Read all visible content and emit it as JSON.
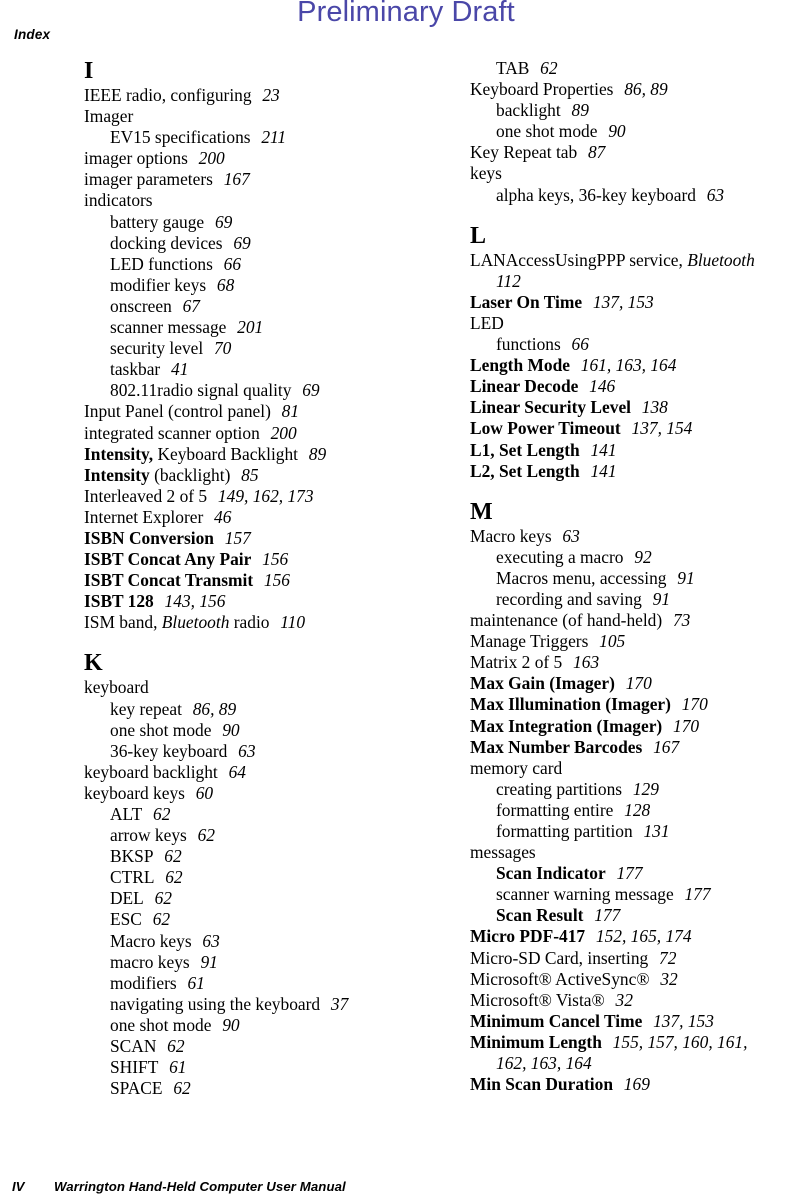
{
  "watermark": {
    "text": "Preliminary Draft",
    "color": "#4a47a8"
  },
  "running_head": {
    "text": "Index"
  },
  "footer": {
    "page_number": "IV",
    "title": "Warrington Hand-Held Computer User Manual"
  },
  "columns": {
    "left": {
      "sections": [
        {
          "letter": "I",
          "entries": [
            {
              "level": 1,
              "text": "IEEE radio, configuring",
              "pages": "23"
            },
            {
              "level": 1,
              "text": "Imager",
              "pages": ""
            },
            {
              "level": 2,
              "text": "EV15 specifications",
              "pages": "211"
            },
            {
              "level": 1,
              "text": "imager options",
              "pages": "200"
            },
            {
              "level": 1,
              "text": "imager parameters",
              "pages": "167"
            },
            {
              "level": 1,
              "text": "indicators",
              "pages": ""
            },
            {
              "level": 2,
              "text": "battery gauge",
              "pages": "69"
            },
            {
              "level": 2,
              "text": "docking devices",
              "pages": "69"
            },
            {
              "level": 2,
              "text": "LED functions",
              "pages": "66"
            },
            {
              "level": 2,
              "text": "modifier keys",
              "pages": "68"
            },
            {
              "level": 2,
              "text": "onscreen",
              "pages": "67"
            },
            {
              "level": 2,
              "text": "scanner message",
              "pages": "201"
            },
            {
              "level": 2,
              "text": "security level",
              "pages": "70"
            },
            {
              "level": 2,
              "text": "taskbar",
              "pages": "41"
            },
            {
              "level": 2,
              "text": "802.11radio signal quality",
              "pages": "69"
            },
            {
              "level": 1,
              "text": "Input Panel (control panel)",
              "pages": "81"
            },
            {
              "level": 1,
              "text": "integrated scanner option",
              "pages": "200"
            },
            {
              "level": 1,
              "bold_part": "Intensity,",
              "text": " Keyboard Backlight",
              "pages": "89"
            },
            {
              "level": 1,
              "bold_part": "Intensity",
              "text": " (backlight)",
              "pages": "85"
            },
            {
              "level": 1,
              "text": "Interleaved 2 of 5",
              "pages": "149, 162, 173"
            },
            {
              "level": 1,
              "text": "Internet Explorer",
              "pages": "46"
            },
            {
              "level": 1,
              "bold": true,
              "text": "ISBN Conversion",
              "pages": "157"
            },
            {
              "level": 1,
              "bold": true,
              "text": "ISBT Concat Any Pair",
              "pages": "156"
            },
            {
              "level": 1,
              "bold": true,
              "text": "ISBT Concat Transmit",
              "pages": "156"
            },
            {
              "level": 1,
              "bold": true,
              "text": "ISBT 128",
              "pages": "143, 156"
            },
            {
              "level": 1,
              "text": "ISM band, ",
              "italic_part": "Bluetooth",
              "text_after": " radio",
              "pages": "110"
            }
          ]
        },
        {
          "letter": "K",
          "entries": [
            {
              "level": 1,
              "text": "keyboard",
              "pages": ""
            },
            {
              "level": 2,
              "text": "key repeat",
              "pages": "86, 89"
            },
            {
              "level": 2,
              "text": "one shot mode",
              "pages": "90"
            },
            {
              "level": 2,
              "text": "36-key keyboard",
              "pages": "63"
            },
            {
              "level": 1,
              "text": "keyboard backlight",
              "pages": "64"
            },
            {
              "level": 1,
              "text": "keyboard keys",
              "pages": "60"
            },
            {
              "level": 2,
              "text": "ALT",
              "pages": "62"
            },
            {
              "level": 2,
              "text": "arrow keys",
              "pages": "62"
            },
            {
              "level": 2,
              "text": "BKSP",
              "pages": "62"
            },
            {
              "level": 2,
              "text": "CTRL",
              "pages": "62"
            },
            {
              "level": 2,
              "text": "DEL",
              "pages": "62"
            },
            {
              "level": 2,
              "text": "ESC",
              "pages": "62"
            },
            {
              "level": 2,
              "text": "Macro keys",
              "pages": "63"
            },
            {
              "level": 2,
              "text": "macro keys",
              "pages": "91"
            },
            {
              "level": 2,
              "text": "modifiers",
              "pages": "61"
            },
            {
              "level": 2,
              "text": "navigating using the keyboard",
              "pages": "37"
            },
            {
              "level": 2,
              "text": "one shot mode",
              "pages": "90"
            },
            {
              "level": 2,
              "text": "SCAN",
              "pages": "62"
            },
            {
              "level": 2,
              "text": "SHIFT",
              "pages": "61"
            },
            {
              "level": 2,
              "text": "SPACE",
              "pages": "62"
            }
          ]
        }
      ]
    },
    "right": {
      "lead_entries": [
        {
          "level": 2,
          "text": "TAB",
          "pages": "62"
        },
        {
          "level": 1,
          "text": "Keyboard Properties",
          "pages": "86, 89"
        },
        {
          "level": 2,
          "text": "backlight",
          "pages": "89"
        },
        {
          "level": 2,
          "text": "one shot mode",
          "pages": "90"
        },
        {
          "level": 1,
          "text": "Key Repeat tab",
          "pages": "87"
        },
        {
          "level": 1,
          "text": "keys",
          "pages": ""
        },
        {
          "level": 2,
          "text": "alpha keys, 36-key keyboard",
          "pages": "63"
        }
      ],
      "sections": [
        {
          "letter": "L",
          "entries": [
            {
              "level": 1,
              "text": "LANAccessUsingPPP service, ",
              "italic_part": "Bluetooth",
              "continuation": "112"
            },
            {
              "level": 1,
              "bold": true,
              "text": "Laser On Time",
              "pages": "137, 153"
            },
            {
              "level": 1,
              "text": "LED",
              "pages": ""
            },
            {
              "level": 2,
              "text": "functions",
              "pages": "66"
            },
            {
              "level": 1,
              "bold": true,
              "text": "Length Mode",
              "pages": "161, 163, 164"
            },
            {
              "level": 1,
              "bold": true,
              "text": "Linear Decode",
              "pages": "146"
            },
            {
              "level": 1,
              "bold": true,
              "text": "Linear Security Level",
              "pages": "138"
            },
            {
              "level": 1,
              "bold": true,
              "text": "Low Power Timeout",
              "pages": "137, 154"
            },
            {
              "level": 1,
              "bold": true,
              "text": "L1, Set Length",
              "pages": "141"
            },
            {
              "level": 1,
              "bold": true,
              "text": "L2, Set Length",
              "pages": "141"
            }
          ]
        },
        {
          "letter": "M",
          "entries": [
            {
              "level": 1,
              "text": "Macro keys",
              "pages": "63"
            },
            {
              "level": 2,
              "text": "executing a macro",
              "pages": "92"
            },
            {
              "level": 2,
              "text": "Macros menu, accessing",
              "pages": "91"
            },
            {
              "level": 2,
              "text": "recording and saving",
              "pages": "91"
            },
            {
              "level": 1,
              "text": "maintenance (of hand-held)",
              "pages": "73"
            },
            {
              "level": 1,
              "text": "Manage Triggers",
              "pages": "105"
            },
            {
              "level": 1,
              "text": "Matrix 2 of 5",
              "pages": "163"
            },
            {
              "level": 1,
              "bold": true,
              "text": "Max Gain (Imager)",
              "pages": "170"
            },
            {
              "level": 1,
              "bold": true,
              "text": "Max Illumination (Imager)",
              "pages": "170"
            },
            {
              "level": 1,
              "bold": true,
              "text": "Max Integration (Imager)",
              "pages": "170"
            },
            {
              "level": 1,
              "bold": true,
              "text": "Max Number Barcodes",
              "pages": "167"
            },
            {
              "level": 1,
              "text": "memory card",
              "pages": ""
            },
            {
              "level": 2,
              "text": "creating partitions",
              "pages": "129"
            },
            {
              "level": 2,
              "text": "formatting entire",
              "pages": "128"
            },
            {
              "level": 2,
              "text": "formatting partition",
              "pages": "131"
            },
            {
              "level": 1,
              "text": "messages",
              "pages": ""
            },
            {
              "level": 2,
              "bold": true,
              "text": "Scan Indicator",
              "pages": "177"
            },
            {
              "level": 2,
              "text": "scanner warning message",
              "pages": "177"
            },
            {
              "level": 2,
              "bold": true,
              "text": "Scan Result",
              "pages": "177"
            },
            {
              "level": 1,
              "bold": true,
              "text": "Micro PDF-417",
              "pages": "152, 165, 174"
            },
            {
              "level": 1,
              "text": "Micro-SD Card, inserting",
              "pages": "72"
            },
            {
              "level": 1,
              "text": "Microsoft® ActiveSync®",
              "pages": "32"
            },
            {
              "level": 1,
              "text": "Microsoft® Vista®",
              "pages": "32"
            },
            {
              "level": 1,
              "bold": true,
              "text": "Minimum Cancel Time",
              "pages": "137, 153"
            },
            {
              "level": 1,
              "bold": true,
              "text": "Minimum Length",
              "pages": "155, 157, 160, 161,",
              "continuation": "162, 163, 164"
            },
            {
              "level": 1,
              "bold": true,
              "text": "Min Scan Duration",
              "pages": "169"
            }
          ]
        }
      ]
    }
  }
}
